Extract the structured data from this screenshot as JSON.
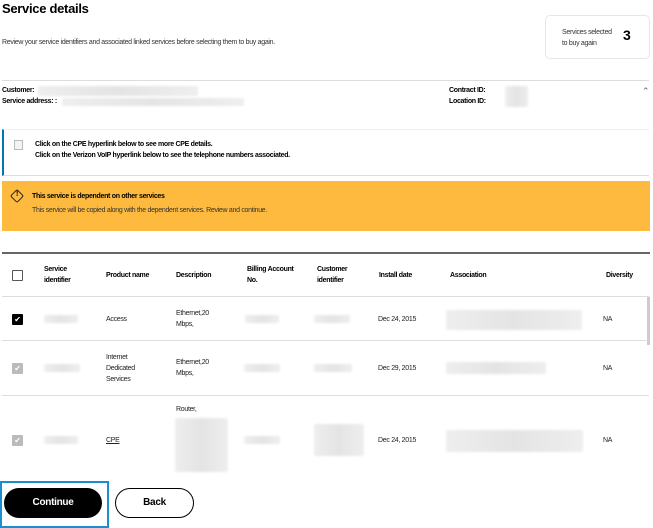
{
  "title": "Service details",
  "subtitle": "Review your service identifiers and associated linked services before selecting them to buy again.",
  "selected": {
    "label_line1": "Services selected",
    "label_line2": "to buy again",
    "count": "3"
  },
  "customer": {
    "customer_label": "Customer:",
    "address_label": "Service address: :",
    "contract_label": "Contract ID:",
    "location_label": "Location ID:"
  },
  "info": {
    "line1": "Click on the CPE hyperlink below to see more CPE details.",
    "line2": "Click on the Verizon VoIP hyperlink below to see the telephone numbers associated."
  },
  "warning": {
    "title": "This service is dependent on other services",
    "body": "This service will be copied along with the dependent services. Review and continue.",
    "color": "#FDBA3F"
  },
  "table": {
    "headers": [
      "Service identifier",
      "Product name",
      "Description",
      "Billing Account No.",
      "Customer identifier",
      "Install date",
      "Association",
      "Diversity"
    ],
    "rows": [
      {
        "product": "Access",
        "description": "Ethernet,20 Mbps,",
        "install_date": "Dec 24, 2015",
        "diversity": "NA",
        "checked": true
      },
      {
        "product": "Internet Dedicated Services",
        "description": "Ethernet,20 Mbps,",
        "install_date": "Dec 29, 2015",
        "diversity": "NA",
        "checked": true
      },
      {
        "product": "CPE",
        "description": "Router,",
        "install_date": "Dec 24, 2015",
        "diversity": "NA",
        "checked": true
      }
    ]
  },
  "buttons": {
    "continue": "Continue",
    "back": "Back"
  }
}
